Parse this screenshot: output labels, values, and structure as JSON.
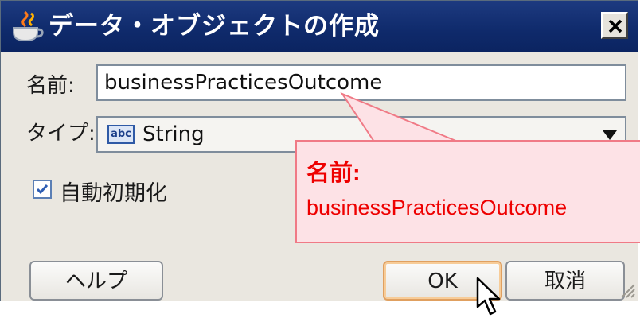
{
  "window": {
    "title": "データ・オブジェクトの作成",
    "icon": "java-cup-icon",
    "close_icon": "close-x-icon"
  },
  "form": {
    "name_label": "名前:",
    "name_value": "businessPracticesOutcome",
    "type_label": "タイプ:",
    "type_icon_text": "abc",
    "type_value": "String",
    "auto_init_label": "自動初期化",
    "auto_init_checked": true
  },
  "buttons": {
    "help": "ヘルプ",
    "ok": "OK",
    "cancel": "取消"
  },
  "callout": {
    "title": "名前:",
    "body": "businessPracticesOutcome"
  },
  "colors": {
    "titlebar": "#0f2a6b",
    "callout_text": "#ee0000",
    "callout_bg": "#fde2e6"
  }
}
